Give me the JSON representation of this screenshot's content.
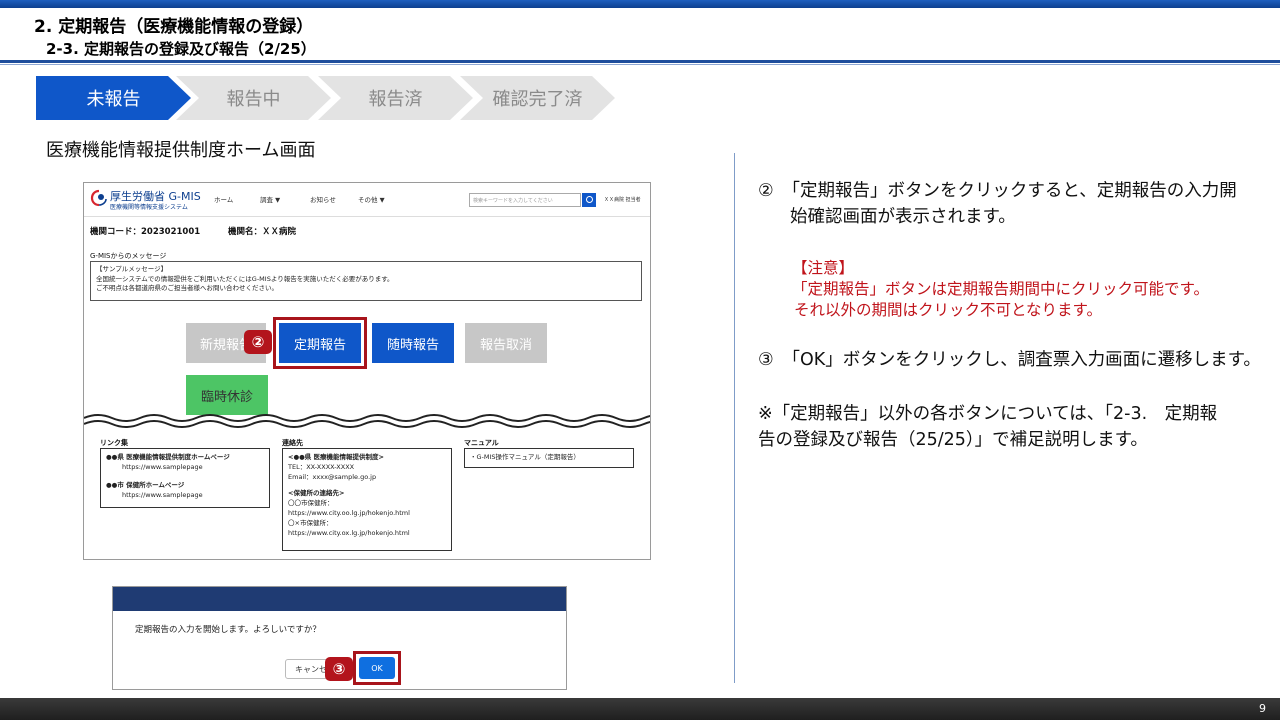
{
  "header": {
    "title": "2. 定期報告（医療機能情報の登録）",
    "subtitle": "2-3. 定期報告の登録及び報告（2/25）"
  },
  "steps": [
    "未報告",
    "報告中",
    "報告済",
    "確認完了済"
  ],
  "screen_caption": "医療機能情報提供制度ホーム画面",
  "mock": {
    "brand": "厚生労働省 G-MIS",
    "brand_sub": "医療機関等情報支援システム",
    "nav": [
      "ホーム",
      "調査 ▼",
      "お知らせ",
      "その他 ▼"
    ],
    "search_placeholder": "検索キーワードを入力してください",
    "user": "ＸＸ病院 担当者",
    "kikan_code": "機関コード：2023021001",
    "kikan_name": "機関名：ＸＸ病院",
    "message_label": "G-MISからのメッセージ",
    "message_lines": [
      "【サンプルメッセージ】",
      "全国統一システムでの情報提供をご利用いただくにはG-MISより報告を実施いただく必要があります。",
      "ご不明点は各都道府県のご担当者様へお問い合わせください。"
    ],
    "buttons": {
      "shinki": "新規報告",
      "teiki": "定期報告",
      "zuiji": "随時報告",
      "torikeshi": "報告取消",
      "rinji": "臨時休診"
    },
    "badge2": "②",
    "links": {
      "title": "リンク集",
      "item1_name": "●●県 医療機能情報提供制度ホームページ",
      "item1_url": "https://www.samplepage",
      "item2_name": "●●市 保健所ホームページ",
      "item2_url": "https://www.samplepage"
    },
    "contact": {
      "title": "連絡先",
      "lines": [
        "<●●県 医療機能情報提供制度>",
        "TEL：XX-XXXX-XXXX",
        "Email：xxxx@sample.go.jp",
        "",
        "<保健所の連絡先>",
        "〇〇市保健所：",
        "https://www.city.oo.lg.jp/hokenjo.html",
        "〇×市保健所：",
        "https://www.city.ox.lg.jp/hokenjo.html"
      ]
    },
    "manual": {
      "title": "マニュアル",
      "item": "・G-MIS操作マニュアル（定期報告）"
    }
  },
  "dialog": {
    "message": "定期報告の入力を開始します。よろしいですか？",
    "cancel": "キャンセル",
    "ok": "OK",
    "badge3": "③"
  },
  "right": {
    "item2_line1": "②　「定期報告」ボタンをクリックすると、定期報告の入力開",
    "item2_line2": "始確認画面が表示されます。",
    "note_title": "【注意】",
    "note_line1": "「定期報告」ボタンは定期報告期間中にクリック可能です。",
    "note_line2": "それ以外の期間はクリック不可となります。",
    "item3": "③　「OK」ボタンをクリックし、調査票入力画面に遷移します。",
    "supp_line1": "※「定期報告」以外の各ボタンについては、「2-3.　定期報",
    "supp_line2": "告の登録及び報告（25/25）」で補足説明します。"
  },
  "page_number": "9",
  "colors": {
    "brand_blue": "#0f57c9",
    "highlight_red": "#a8141b",
    "note_red": "#c0141b",
    "green": "#4dc565"
  }
}
